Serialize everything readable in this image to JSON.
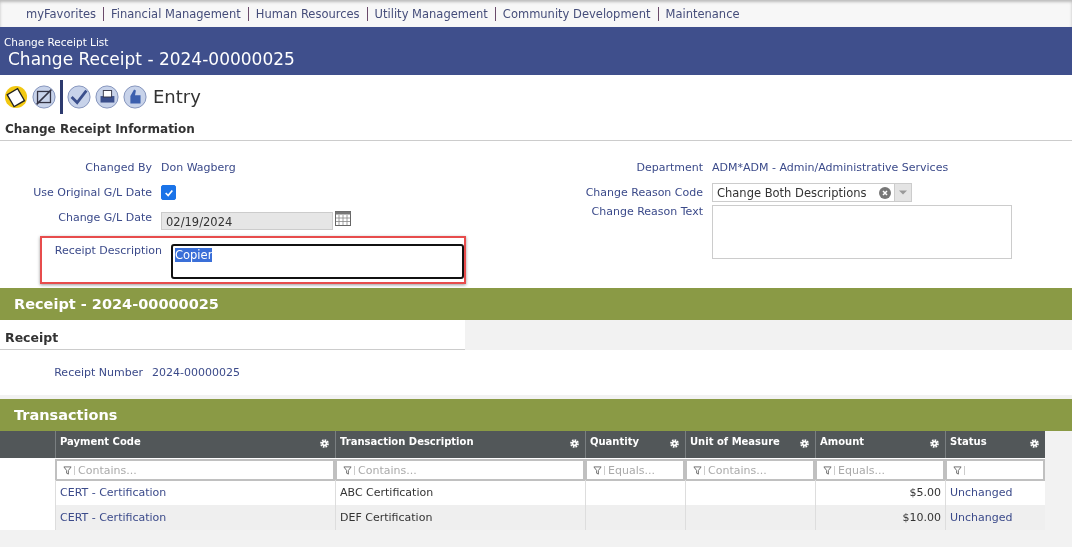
{
  "nav": [
    "myFavorites",
    "Financial Management",
    "Human Resources",
    "Utility Management",
    "Community Development",
    "Maintenance"
  ],
  "header": {
    "breadcrumb": "Change Receipt List",
    "title": "Change Receipt - 2024-00000025"
  },
  "toolbar": {
    "mode": "Entry"
  },
  "info": {
    "title": "Change Receipt Information",
    "changed_by": {
      "label": "Changed By",
      "value": "Don Wagberg"
    },
    "use_original": {
      "label": "Use Original G/L Date",
      "checked": true
    },
    "gl_date": {
      "label": "Change G/L Date",
      "value": "02/19/2024"
    },
    "description": {
      "label": "Receipt Description",
      "value": "Copier",
      "text_selected": true,
      "highlighted": true
    },
    "department": {
      "label": "Department",
      "value": "ADM*ADM - Admin/Administrative Services"
    },
    "reason_code": {
      "label": "Change Reason Code",
      "value": "Change Both Descriptions"
    },
    "reason_text": {
      "label": "Change Reason Text"
    }
  },
  "receipt_band": "Receipt - 2024-00000025",
  "receipt": {
    "title": "Receipt",
    "label": "Receipt Number",
    "value": "2024-00000025"
  },
  "transactions": {
    "title": "Transactions",
    "columns": [
      {
        "name": "Payment Code",
        "filter": "Contains...",
        "kind": "link"
      },
      {
        "name": "Transaction Description",
        "filter": "Contains...",
        "kind": "text"
      },
      {
        "name": "Quantity",
        "filter": "Equals...",
        "kind": "text"
      },
      {
        "name": "Unit of Measure",
        "filter": "Contains...",
        "kind": "text"
      },
      {
        "name": "Amount",
        "filter": "Equals...",
        "kind": "number"
      },
      {
        "name": "Status",
        "kind": "link"
      }
    ],
    "rows": [
      [
        "CERT - Certification",
        "ABC Certification",
        "",
        "",
        "$5.00",
        "Unchanged"
      ],
      [
        "CERT - Certification",
        "DEF Certification",
        "",
        "",
        "$10.00",
        "Unchanged"
      ]
    ]
  }
}
